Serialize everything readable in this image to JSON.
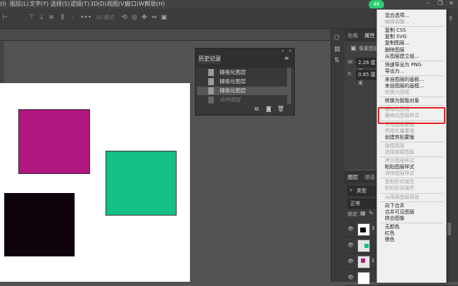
{
  "menubar": {
    "items": [
      "(I)",
      "图层(L)",
      "文字(Y)",
      "选择(S)",
      "滤镜(T)",
      "3D(D)",
      "视图(V)",
      "窗口(W)",
      "帮助(H)"
    ]
  },
  "options_bar": {
    "mode_3d_label": "3D 模式：",
    "badge_count": "46"
  },
  "history_panel": {
    "title": "历史记录",
    "items": [
      {
        "label": "栅格化图层",
        "state": "normal"
      },
      {
        "label": "栅格化图层",
        "state": "normal"
      },
      {
        "label": "栅格化图层",
        "state": "active"
      },
      {
        "label": "合并图层",
        "state": "dim"
      }
    ]
  },
  "properties_panel": {
    "tabs": [
      "色板",
      "属性"
    ],
    "subtitle": "像素图层",
    "w_label": "W:",
    "w_value": "2.26 厘米",
    "x_label": "X:",
    "x_value": "0.85 厘米"
  },
  "layers_panel": {
    "tabs": [
      "图层",
      "通道"
    ],
    "filter_label": "类型",
    "blend_mode": "正常",
    "lock_label": "锁定：",
    "layer_numbers": [
      "3",
      "",
      "1",
      ""
    ]
  },
  "context_menu": {
    "items": [
      {
        "label": "混合选项...",
        "enabled": true
      },
      {
        "label": "编辑调整...",
        "enabled": false
      },
      {
        "sep": true
      },
      {
        "label": "复制 CSS",
        "enabled": true
      },
      {
        "label": "复制 SVG",
        "enabled": true
      },
      {
        "label": "复制图层...",
        "enabled": true
      },
      {
        "label": "删除图层",
        "enabled": true
      },
      {
        "label": "从图层建立组...",
        "enabled": true
      },
      {
        "sep": true
      },
      {
        "label": "快速导出为 PNG",
        "enabled": true
      },
      {
        "label": "导出为...",
        "enabled": true
      },
      {
        "sep": true
      },
      {
        "label": "来自图层的画板...",
        "enabled": true
      },
      {
        "label": "来自图层的画框...",
        "enabled": true
      },
      {
        "label": "转换为图框",
        "enabled": false
      },
      {
        "sep": true
      },
      {
        "label": "转换为智能对象",
        "enabled": true,
        "highlighted": true
      },
      {
        "sep": true
      },
      {
        "label": "栅格化图层",
        "enabled": false
      },
      {
        "label": "栅格化图层样式",
        "enabled": false
      },
      {
        "sep": true
      },
      {
        "label": "停用图层蒙版",
        "enabled": false
      },
      {
        "label": "停用矢量蒙版",
        "enabled": false
      },
      {
        "label": "创建剪贴蒙版",
        "enabled": true
      },
      {
        "sep": true
      },
      {
        "label": "链接图层",
        "enabled": false
      },
      {
        "label": "选择链接图层",
        "enabled": false
      },
      {
        "sep": true
      },
      {
        "label": "拷贝图层样式",
        "enabled": false
      },
      {
        "label": "粘贴图层样式",
        "enabled": true
      },
      {
        "label": "清除图层样式",
        "enabled": false
      },
      {
        "sep": true
      },
      {
        "label": "复制形状属性",
        "enabled": false
      },
      {
        "label": "粘贴形状属性",
        "enabled": false
      },
      {
        "sep": true
      },
      {
        "label": "从隔离图层释放",
        "enabled": false
      },
      {
        "sep": true
      },
      {
        "label": "向下合并",
        "enabled": true
      },
      {
        "label": "合并可见图层",
        "enabled": true
      },
      {
        "label": "拼合图像",
        "enabled": true
      },
      {
        "sep": true
      },
      {
        "label": "无颜色",
        "enabled": true
      },
      {
        "label": "红色",
        "enabled": true
      },
      {
        "label": "橙色",
        "enabled": true
      }
    ]
  },
  "canvas": {
    "shapes": [
      {
        "name": "magenta-square",
        "color": "#b0187f"
      },
      {
        "name": "green-square",
        "color": "#15c084"
      },
      {
        "name": "black-square",
        "color": "#0e030b"
      }
    ]
  },
  "colors": {
    "accent_highlight": "#e02020",
    "badge": "#2ecc71"
  }
}
